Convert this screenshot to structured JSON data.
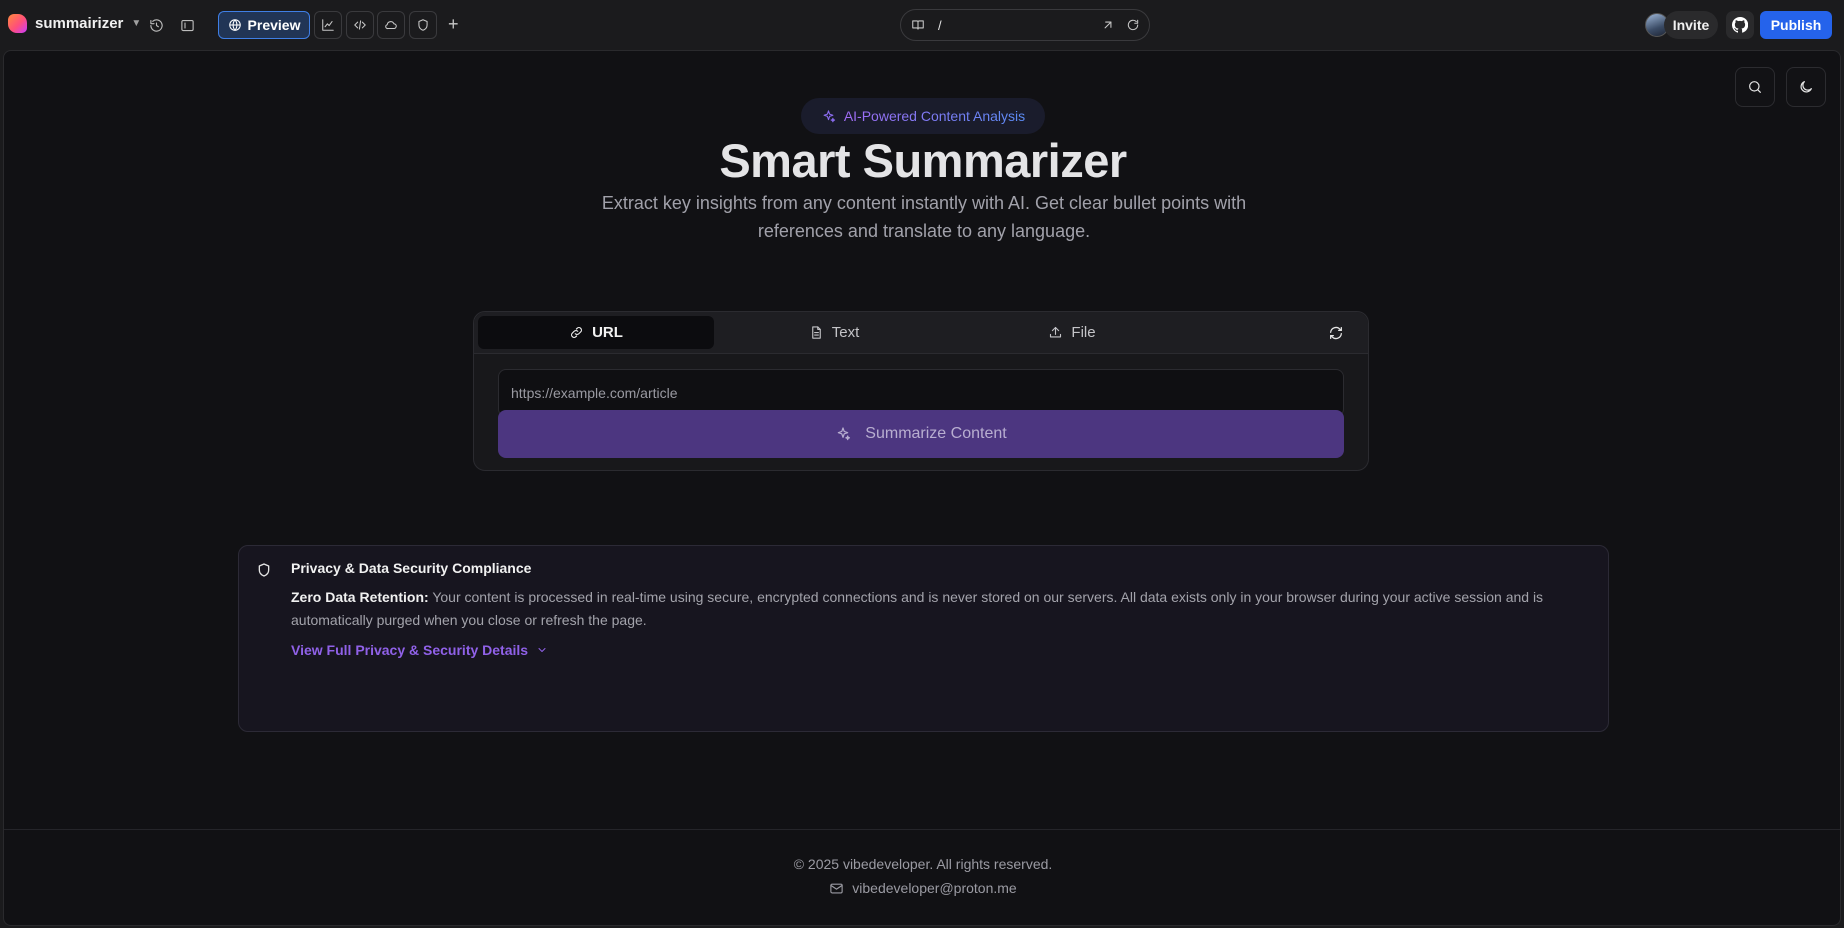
{
  "topbar": {
    "project_name": "summairizer",
    "preview_label": "Preview",
    "path": "/",
    "invite_label": "Invite",
    "publish_label": "Publish"
  },
  "hero": {
    "badge": "AI-Powered Content Analysis",
    "title": "Smart Summarizer",
    "subtitle": "Extract key insights from any content instantly with AI. Get clear bullet points with references and translate to any language."
  },
  "tabs": [
    {
      "label": "URL",
      "icon": "link-icon",
      "active": true
    },
    {
      "label": "Text",
      "icon": "file-text-icon",
      "active": false
    },
    {
      "label": "File",
      "icon": "upload-icon",
      "active": false
    }
  ],
  "form": {
    "url_value": "",
    "url_placeholder": "https://example.com/article",
    "submit_label": "Summarize Content"
  },
  "privacy": {
    "heading": "Privacy & Data Security Compliance",
    "lead": "Zero Data Retention:",
    "body": " Your content is processed in real-time using secure, encrypted connections and is never stored on our servers. All data exists only in your browser during your active session and is automatically purged when you close or refresh the page.",
    "link": "View Full Privacy & Security Details"
  },
  "footer": {
    "copyright": "© 2025 vibedeveloper. All rights reserved.",
    "email": "vibedeveloper@proton.me"
  },
  "colors": {
    "accent": "#2563eb",
    "purple": "#4c3680",
    "link": "#9061e8",
    "background": "#111114"
  }
}
